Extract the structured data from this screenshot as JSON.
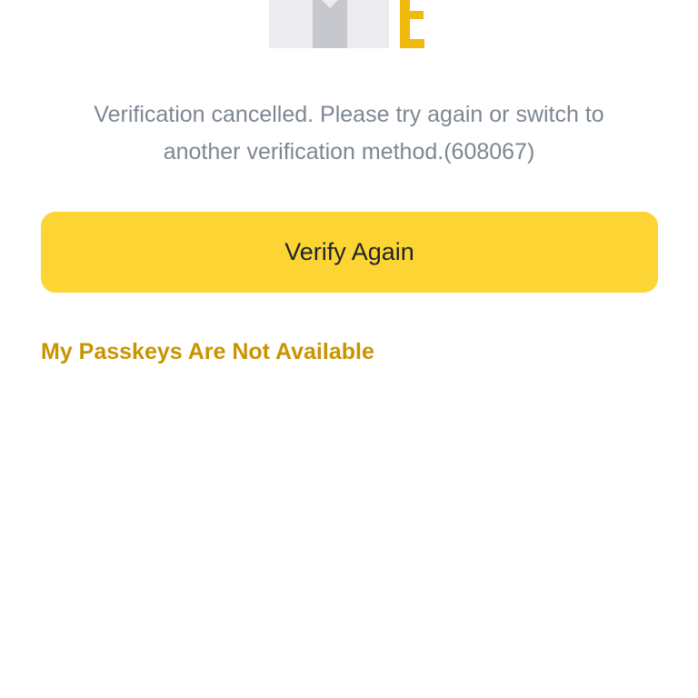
{
  "illustration": {
    "icon": "passkey-illustration-icon",
    "colors": {
      "card": "#eaecef",
      "card_center": "#c6c9cf",
      "accent": "#f0b90b"
    }
  },
  "message": {
    "text": "Verification cancelled. Please try again or switch to another verification method.(608067)",
    "color": "#7d8792"
  },
  "primary_action": {
    "label": "Verify Again",
    "color": "#fcd535"
  },
  "secondary_action": {
    "label": "My Passkeys Are Not Available",
    "color": "#c99400"
  }
}
